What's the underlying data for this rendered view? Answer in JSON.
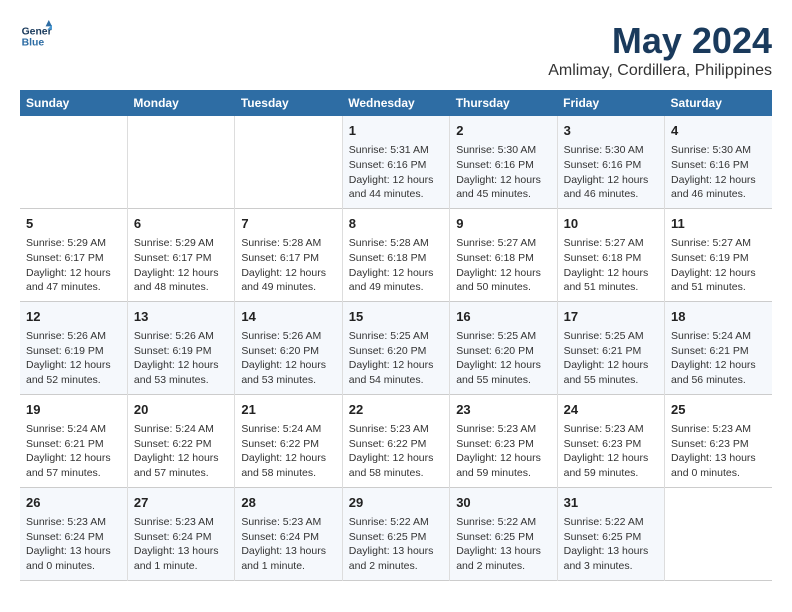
{
  "header": {
    "logo_line1": "General",
    "logo_line2": "Blue",
    "month": "May 2024",
    "location": "Amlimay, Cordillera, Philippines"
  },
  "weekdays": [
    "Sunday",
    "Monday",
    "Tuesday",
    "Wednesday",
    "Thursday",
    "Friday",
    "Saturday"
  ],
  "weeks": [
    [
      {
        "day": "",
        "info": ""
      },
      {
        "day": "",
        "info": ""
      },
      {
        "day": "",
        "info": ""
      },
      {
        "day": "1",
        "info": "Sunrise: 5:31 AM\nSunset: 6:16 PM\nDaylight: 12 hours\nand 44 minutes."
      },
      {
        "day": "2",
        "info": "Sunrise: 5:30 AM\nSunset: 6:16 PM\nDaylight: 12 hours\nand 45 minutes."
      },
      {
        "day": "3",
        "info": "Sunrise: 5:30 AM\nSunset: 6:16 PM\nDaylight: 12 hours\nand 46 minutes."
      },
      {
        "day": "4",
        "info": "Sunrise: 5:30 AM\nSunset: 6:16 PM\nDaylight: 12 hours\nand 46 minutes."
      }
    ],
    [
      {
        "day": "5",
        "info": "Sunrise: 5:29 AM\nSunset: 6:17 PM\nDaylight: 12 hours\nand 47 minutes."
      },
      {
        "day": "6",
        "info": "Sunrise: 5:29 AM\nSunset: 6:17 PM\nDaylight: 12 hours\nand 48 minutes."
      },
      {
        "day": "7",
        "info": "Sunrise: 5:28 AM\nSunset: 6:17 PM\nDaylight: 12 hours\nand 49 minutes."
      },
      {
        "day": "8",
        "info": "Sunrise: 5:28 AM\nSunset: 6:18 PM\nDaylight: 12 hours\nand 49 minutes."
      },
      {
        "day": "9",
        "info": "Sunrise: 5:27 AM\nSunset: 6:18 PM\nDaylight: 12 hours\nand 50 minutes."
      },
      {
        "day": "10",
        "info": "Sunrise: 5:27 AM\nSunset: 6:18 PM\nDaylight: 12 hours\nand 51 minutes."
      },
      {
        "day": "11",
        "info": "Sunrise: 5:27 AM\nSunset: 6:19 PM\nDaylight: 12 hours\nand 51 minutes."
      }
    ],
    [
      {
        "day": "12",
        "info": "Sunrise: 5:26 AM\nSunset: 6:19 PM\nDaylight: 12 hours\nand 52 minutes."
      },
      {
        "day": "13",
        "info": "Sunrise: 5:26 AM\nSunset: 6:19 PM\nDaylight: 12 hours\nand 53 minutes."
      },
      {
        "day": "14",
        "info": "Sunrise: 5:26 AM\nSunset: 6:20 PM\nDaylight: 12 hours\nand 53 minutes."
      },
      {
        "day": "15",
        "info": "Sunrise: 5:25 AM\nSunset: 6:20 PM\nDaylight: 12 hours\nand 54 minutes."
      },
      {
        "day": "16",
        "info": "Sunrise: 5:25 AM\nSunset: 6:20 PM\nDaylight: 12 hours\nand 55 minutes."
      },
      {
        "day": "17",
        "info": "Sunrise: 5:25 AM\nSunset: 6:21 PM\nDaylight: 12 hours\nand 55 minutes."
      },
      {
        "day": "18",
        "info": "Sunrise: 5:24 AM\nSunset: 6:21 PM\nDaylight: 12 hours\nand 56 minutes."
      }
    ],
    [
      {
        "day": "19",
        "info": "Sunrise: 5:24 AM\nSunset: 6:21 PM\nDaylight: 12 hours\nand 57 minutes."
      },
      {
        "day": "20",
        "info": "Sunrise: 5:24 AM\nSunset: 6:22 PM\nDaylight: 12 hours\nand 57 minutes."
      },
      {
        "day": "21",
        "info": "Sunrise: 5:24 AM\nSunset: 6:22 PM\nDaylight: 12 hours\nand 58 minutes."
      },
      {
        "day": "22",
        "info": "Sunrise: 5:23 AM\nSunset: 6:22 PM\nDaylight: 12 hours\nand 58 minutes."
      },
      {
        "day": "23",
        "info": "Sunrise: 5:23 AM\nSunset: 6:23 PM\nDaylight: 12 hours\nand 59 minutes."
      },
      {
        "day": "24",
        "info": "Sunrise: 5:23 AM\nSunset: 6:23 PM\nDaylight: 12 hours\nand 59 minutes."
      },
      {
        "day": "25",
        "info": "Sunrise: 5:23 AM\nSunset: 6:23 PM\nDaylight: 13 hours\nand 0 minutes."
      }
    ],
    [
      {
        "day": "26",
        "info": "Sunrise: 5:23 AM\nSunset: 6:24 PM\nDaylight: 13 hours\nand 0 minutes."
      },
      {
        "day": "27",
        "info": "Sunrise: 5:23 AM\nSunset: 6:24 PM\nDaylight: 13 hours\nand 1 minute."
      },
      {
        "day": "28",
        "info": "Sunrise: 5:23 AM\nSunset: 6:24 PM\nDaylight: 13 hours\nand 1 minute."
      },
      {
        "day": "29",
        "info": "Sunrise: 5:22 AM\nSunset: 6:25 PM\nDaylight: 13 hours\nand 2 minutes."
      },
      {
        "day": "30",
        "info": "Sunrise: 5:22 AM\nSunset: 6:25 PM\nDaylight: 13 hours\nand 2 minutes."
      },
      {
        "day": "31",
        "info": "Sunrise: 5:22 AM\nSunset: 6:25 PM\nDaylight: 13 hours\nand 3 minutes."
      },
      {
        "day": "",
        "info": ""
      }
    ]
  ]
}
